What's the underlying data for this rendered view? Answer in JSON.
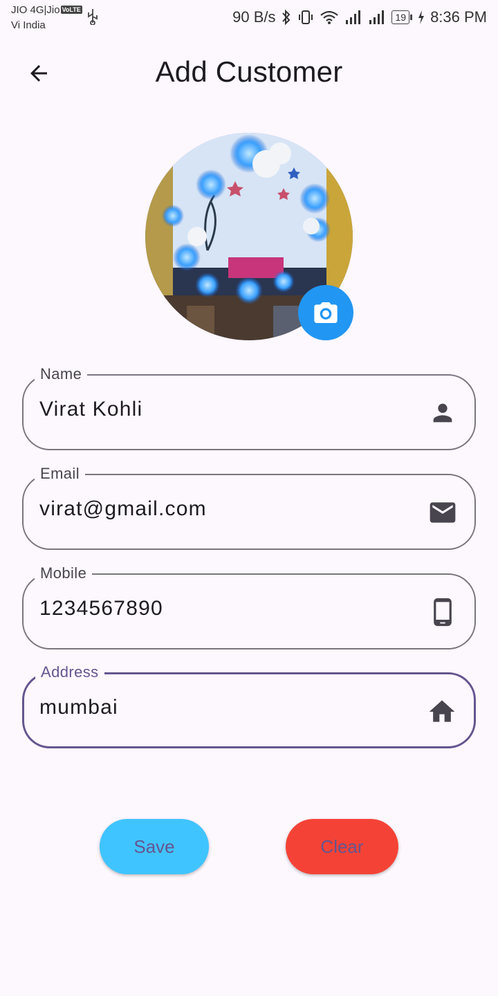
{
  "status_bar": {
    "carrier1": "JIO 4G|Jio",
    "volte": "VoLTE",
    "carrier2": "Vi India",
    "net_speed": "90 B/s",
    "battery": "19",
    "time": "8:36 PM"
  },
  "appbar": {
    "title": "Add Customer",
    "back_icon": "arrow-left-icon"
  },
  "avatar": {
    "camera_icon": "camera-icon",
    "camera_button_color": "#2196f3"
  },
  "fields": [
    {
      "label": "Name",
      "value": "Virat Kohli",
      "icon": "person-icon",
      "focused": false
    },
    {
      "label": "Email",
      "value": "virat@gmail.com",
      "icon": "email-icon",
      "focused": false
    },
    {
      "label": "Mobile",
      "value": "1234567890",
      "icon": "phone-icon",
      "focused": false
    },
    {
      "label": "Address",
      "value": "mumbai",
      "icon": "home-icon",
      "focused": true
    }
  ],
  "buttons": {
    "save_label": "Save",
    "clear_label": "Clear",
    "save_color": "#40c4ff",
    "clear_color": "#f44336"
  },
  "colors": {
    "background": "#fdf7fe",
    "accent": "#65558f",
    "outline": "#79747e"
  }
}
